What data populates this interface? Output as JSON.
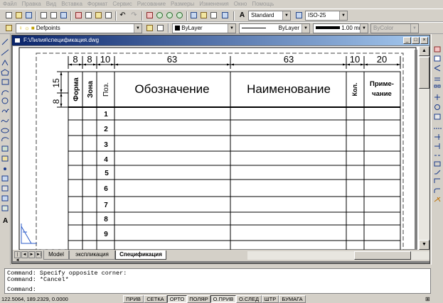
{
  "menu": [
    "Файл",
    "Правка",
    "Вид",
    "Вставка",
    "Формат",
    "Сервис",
    "Рисование",
    "Размеры",
    "Изменения",
    "Окно",
    "Помощь"
  ],
  "toolbar": {
    "text_style": "Standard",
    "dim_style": "ISO-25",
    "layer": "Defpoints",
    "color": "ByLayer",
    "linetype": "ByLayer",
    "lineweight": "1.00 mm",
    "plot_style": "ByColor"
  },
  "document": {
    "title": "F:\\Лилия\\спецификация.dwg"
  },
  "spec": {
    "dims": {
      "d8a": "8",
      "d8b": "8",
      "d10a": "10",
      "d63a": "63",
      "d63b": "63",
      "d10b": "10",
      "d20": "20",
      "d15": "15",
      "d8c": "8"
    },
    "headers": {
      "forma": "Форма",
      "zona": "Зона",
      "poz": "Поз.",
      "oboznachenie": "Обозначение",
      "naimenovanie": "Наименование",
      "kol": "Кол.",
      "primechanie_1": "Приме-",
      "primechanie_2": "чание"
    },
    "row_numbers": [
      "1",
      "2",
      "3",
      "4",
      "5",
      "6",
      "7",
      "8",
      "9"
    ]
  },
  "tabs": [
    "Model",
    "экспликация",
    "Спецификация"
  ],
  "command": {
    "line1": "Command: Specify opposite corner:",
    "line2": "Command: *Cancel*",
    "line3": "Command:"
  },
  "status": {
    "coords": "122.5064, 189.2329, 0.0000",
    "buttons": [
      "ПРИВ",
      "СЕТКА",
      "ОРТО",
      "ПОЛЯР",
      "О.ПРИВ",
      "О.СЛЕД",
      "ШТР",
      "БУМАГА"
    ]
  }
}
